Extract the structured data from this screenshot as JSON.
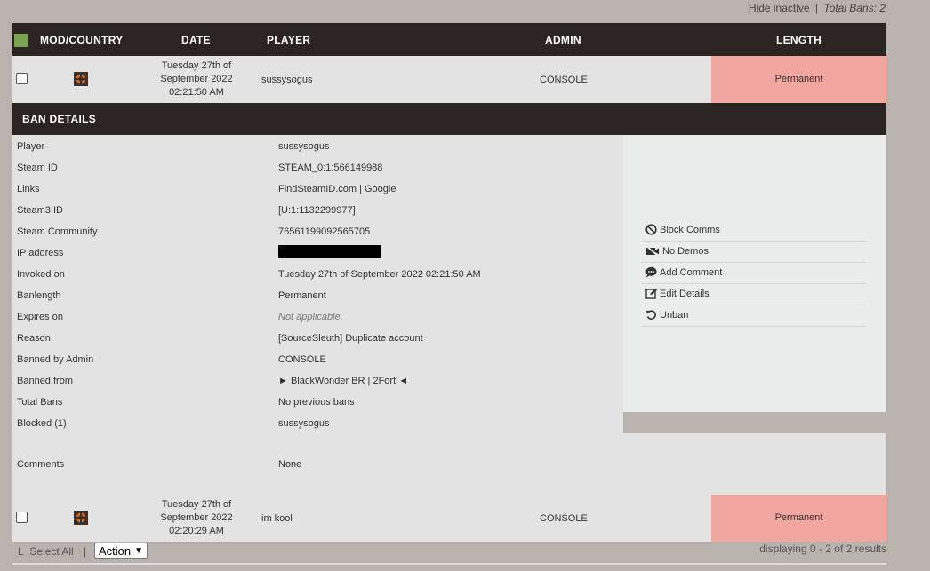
{
  "topline": {
    "hide_inactive": "Hide inactive",
    "separator": "|",
    "total_bans": "Total Bans: 2"
  },
  "columns": {
    "mod": "MOD/COUNTRY",
    "date": "DATE",
    "player": "PLAYER",
    "admin": "ADMIN",
    "length": "LENGTH"
  },
  "bans": [
    {
      "date_line1": "Tuesday 27th of",
      "date_line2": "September 2022",
      "date_line3": "02:21:50 AM",
      "player": "sussysogus",
      "admin": "CONSOLE",
      "length": "Permanent"
    },
    {
      "date_line1": "Tuesday 27th of",
      "date_line2": "September 2022",
      "date_line3": "02:20:29 AM",
      "player": "im kool",
      "admin": "CONSOLE",
      "length": "Permanent"
    }
  ],
  "details": {
    "title": "BAN DETAILS",
    "rows": [
      {
        "label": "Player",
        "value": "sussysogus"
      },
      {
        "label": "Steam ID",
        "value": "STEAM_0:1:566149988"
      },
      {
        "label": "Links",
        "value": "FindSteamID.com | Google"
      },
      {
        "label": "Steam3 ID",
        "value": "[U:1:1132299977]"
      },
      {
        "label": "Steam Community",
        "value": "76561199092565705"
      },
      {
        "label": "IP address",
        "value": ""
      },
      {
        "label": "Invoked on",
        "value": "Tuesday 27th of September 2022 02:21:50 AM"
      },
      {
        "label": "Banlength",
        "value": "Permanent"
      },
      {
        "label": "Expires on",
        "value": "Not applicable."
      },
      {
        "label": "Reason",
        "value": "[SourceSleuth] Duplicate account"
      },
      {
        "label": "Banned by Admin",
        "value": "CONSOLE"
      },
      {
        "label": "Banned from",
        "value": "► BlackWonder BR | 2Fort ◄"
      },
      {
        "label": "Total Bans",
        "value": "No previous bans"
      },
      {
        "label": "Blocked (1)",
        "value": "sussysogus"
      },
      {
        "label": "Comments",
        "value": "None"
      }
    ],
    "actions": [
      {
        "label": "Block Comms",
        "icon": "block-icon"
      },
      {
        "label": "No Demos",
        "icon": "no-video-icon"
      },
      {
        "label": "Add Comment",
        "icon": "comment-icon"
      },
      {
        "label": "Edit Details",
        "icon": "edit-icon"
      },
      {
        "label": "Unban",
        "icon": "undo-icon"
      }
    ]
  },
  "footer": {
    "l_char": "L",
    "select_all": "Select All",
    "separator": "|",
    "action_select": "Action",
    "count": "displaying 0 - 2 of 2 results"
  },
  "colors": {
    "header_bg": "#2a2520",
    "permanent_bg": "#f1a7a0",
    "row_bg": "#e3e3e3",
    "page_bg": "#b9b3ae",
    "header_square": "#7aa350"
  }
}
